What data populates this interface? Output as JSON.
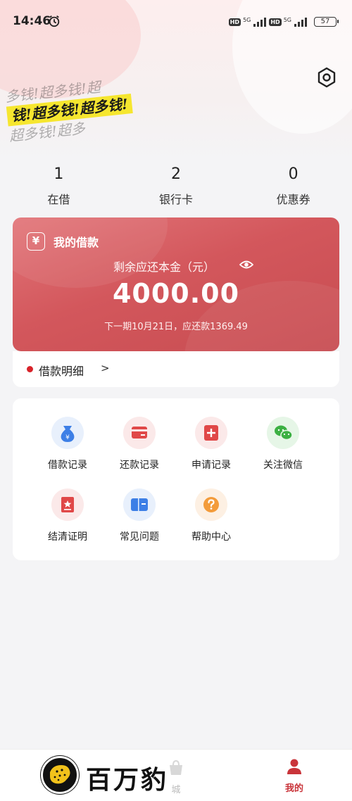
{
  "status_bar": {
    "time": "14:46",
    "hd1": "HD",
    "net1": "5G",
    "hd2": "HD",
    "net2": "5G",
    "battery": "57"
  },
  "slogan": {
    "row1": "多钱!超多钱!超",
    "row2": "钱!超多钱!超多钱!",
    "row3": "超多钱!超多"
  },
  "stats": [
    {
      "value": "1",
      "label": "在借"
    },
    {
      "value": "2",
      "label": "银行卡"
    },
    {
      "value": "0",
      "label": "优惠券"
    }
  ],
  "loan_card": {
    "icon_glyph": "¥",
    "title": "我的借款",
    "subtitle": "剩余应还本金（元）",
    "amount": "4000.00",
    "due_text": "下一期10月21日，应还款1369.49",
    "color_accent": "#d3575c"
  },
  "detail_row": {
    "label": "借款明细",
    "chevron": ">"
  },
  "menu": {
    "items": [
      {
        "label": "借款记录",
        "icon": "money-bag-icon",
        "icon_color": "#3d7fe6",
        "bg": "#e8f0fc"
      },
      {
        "label": "还款记录",
        "icon": "card-icon",
        "icon_color": "#e04848",
        "bg": "#fbe9e9"
      },
      {
        "label": "申请记录",
        "icon": "plus-icon",
        "icon_color": "#e04848",
        "bg": "#fbe9e9"
      },
      {
        "label": "关注微信",
        "icon": "wechat-icon",
        "icon_color": "#3cb043",
        "bg": "#e6f6e7"
      },
      {
        "label": "结清证明",
        "icon": "certificate-icon",
        "icon_color": "#e04848",
        "bg": "#fbe9e9"
      },
      {
        "label": "常见问题",
        "icon": "book-icon",
        "icon_color": "#3d7fe6",
        "bg": "#e8f0fc"
      },
      {
        "label": "帮助中心",
        "icon": "question-icon",
        "icon_color": "#f39b3a",
        "bg": "#fdf0e3"
      }
    ]
  },
  "tabbar": {
    "mall_label": "城",
    "mine_label": "我的",
    "active_color": "#c9343a"
  },
  "watermark": {
    "text": "百万豹"
  }
}
